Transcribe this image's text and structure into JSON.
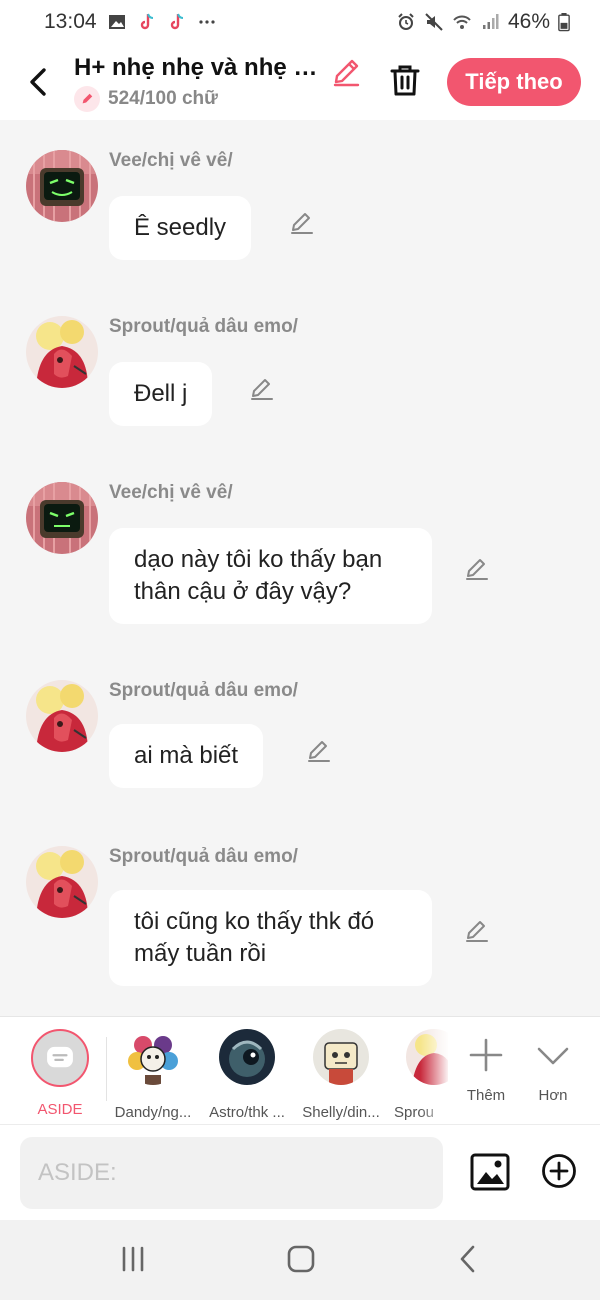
{
  "status_bar": {
    "time": "13:04",
    "battery": "46%",
    "left_icons": [
      "gallery-icon",
      "tiktok-icon",
      "tiktok-icon",
      "more-dots-icon"
    ],
    "right_icons": [
      "alarm-icon",
      "mute-icon",
      "wifi-icon",
      "signal-icon",
      "battery-icon"
    ]
  },
  "header": {
    "title": "H+ nhẹ nhẹ và nhẹ nhàng",
    "word_count": "524/100 chữ",
    "next_label": "Tiếp theo"
  },
  "messages": [
    {
      "speaker": "Vee/chị vê vê/",
      "text": "Ê seedly",
      "avatar": "vee"
    },
    {
      "speaker": "Sprout/quả dâu emo/",
      "text": "Đell j",
      "avatar": "sprout"
    },
    {
      "speaker": "Vee/chị vê vê/",
      "text": "dạo này tôi ko thấy bạn thân cậu ở đây vậy?",
      "avatar": "vee"
    },
    {
      "speaker": "Sprout/quả dâu emo/",
      "text": "ai mà biết",
      "avatar": "sprout"
    },
    {
      "speaker": "Sprout/quả dâu emo/",
      "text": "tôi cũng ko thấy thk đó mấy tuần rồi",
      "avatar": "sprout"
    }
  ],
  "characters": [
    {
      "label": "ASIDE",
      "selected": true
    },
    {
      "label": "Dandy/ng..."
    },
    {
      "label": "Astro/thk ..."
    },
    {
      "label": "Shelly/din..."
    },
    {
      "label": "Sprou"
    }
  ],
  "char_actions": {
    "add_label": "Thêm",
    "more_label": "Hơn"
  },
  "input": {
    "placeholder": "ASIDE:",
    "value": ""
  },
  "colors": {
    "accent": "#f2566f",
    "background": "#f5f5f5",
    "bubble": "#ffffff",
    "speaker": "#8a8a8a"
  }
}
